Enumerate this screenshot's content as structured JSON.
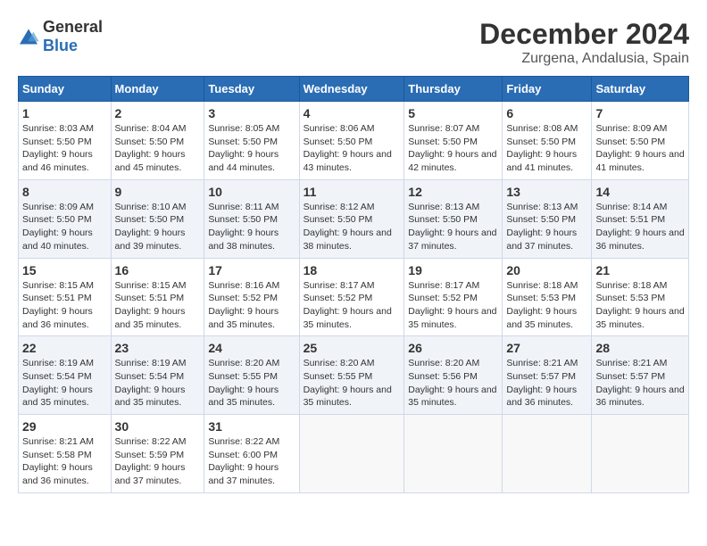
{
  "logo": {
    "general": "General",
    "blue": "Blue"
  },
  "title": "December 2024",
  "subtitle": "Zurgena, Andalusia, Spain",
  "days_of_week": [
    "Sunday",
    "Monday",
    "Tuesday",
    "Wednesday",
    "Thursday",
    "Friday",
    "Saturday"
  ],
  "weeks": [
    [
      {
        "day": 1,
        "sunrise": "Sunrise: 8:03 AM",
        "sunset": "Sunset: 5:50 PM",
        "daylight": "Daylight: 9 hours and 46 minutes."
      },
      {
        "day": 2,
        "sunrise": "Sunrise: 8:04 AM",
        "sunset": "Sunset: 5:50 PM",
        "daylight": "Daylight: 9 hours and 45 minutes."
      },
      {
        "day": 3,
        "sunrise": "Sunrise: 8:05 AM",
        "sunset": "Sunset: 5:50 PM",
        "daylight": "Daylight: 9 hours and 44 minutes."
      },
      {
        "day": 4,
        "sunrise": "Sunrise: 8:06 AM",
        "sunset": "Sunset: 5:50 PM",
        "daylight": "Daylight: 9 hours and 43 minutes."
      },
      {
        "day": 5,
        "sunrise": "Sunrise: 8:07 AM",
        "sunset": "Sunset: 5:50 PM",
        "daylight": "Daylight: 9 hours and 42 minutes."
      },
      {
        "day": 6,
        "sunrise": "Sunrise: 8:08 AM",
        "sunset": "Sunset: 5:50 PM",
        "daylight": "Daylight: 9 hours and 41 minutes."
      },
      {
        "day": 7,
        "sunrise": "Sunrise: 8:09 AM",
        "sunset": "Sunset: 5:50 PM",
        "daylight": "Daylight: 9 hours and 41 minutes."
      }
    ],
    [
      {
        "day": 8,
        "sunrise": "Sunrise: 8:09 AM",
        "sunset": "Sunset: 5:50 PM",
        "daylight": "Daylight: 9 hours and 40 minutes."
      },
      {
        "day": 9,
        "sunrise": "Sunrise: 8:10 AM",
        "sunset": "Sunset: 5:50 PM",
        "daylight": "Daylight: 9 hours and 39 minutes."
      },
      {
        "day": 10,
        "sunrise": "Sunrise: 8:11 AM",
        "sunset": "Sunset: 5:50 PM",
        "daylight": "Daylight: 9 hours and 38 minutes."
      },
      {
        "day": 11,
        "sunrise": "Sunrise: 8:12 AM",
        "sunset": "Sunset: 5:50 PM",
        "daylight": "Daylight: 9 hours and 38 minutes."
      },
      {
        "day": 12,
        "sunrise": "Sunrise: 8:13 AM",
        "sunset": "Sunset: 5:50 PM",
        "daylight": "Daylight: 9 hours and 37 minutes."
      },
      {
        "day": 13,
        "sunrise": "Sunrise: 8:13 AM",
        "sunset": "Sunset: 5:50 PM",
        "daylight": "Daylight: 9 hours and 37 minutes."
      },
      {
        "day": 14,
        "sunrise": "Sunrise: 8:14 AM",
        "sunset": "Sunset: 5:51 PM",
        "daylight": "Daylight: 9 hours and 36 minutes."
      }
    ],
    [
      {
        "day": 15,
        "sunrise": "Sunrise: 8:15 AM",
        "sunset": "Sunset: 5:51 PM",
        "daylight": "Daylight: 9 hours and 36 minutes."
      },
      {
        "day": 16,
        "sunrise": "Sunrise: 8:15 AM",
        "sunset": "Sunset: 5:51 PM",
        "daylight": "Daylight: 9 hours and 35 minutes."
      },
      {
        "day": 17,
        "sunrise": "Sunrise: 8:16 AM",
        "sunset": "Sunset: 5:52 PM",
        "daylight": "Daylight: 9 hours and 35 minutes."
      },
      {
        "day": 18,
        "sunrise": "Sunrise: 8:17 AM",
        "sunset": "Sunset: 5:52 PM",
        "daylight": "Daylight: 9 hours and 35 minutes."
      },
      {
        "day": 19,
        "sunrise": "Sunrise: 8:17 AM",
        "sunset": "Sunset: 5:52 PM",
        "daylight": "Daylight: 9 hours and 35 minutes."
      },
      {
        "day": 20,
        "sunrise": "Sunrise: 8:18 AM",
        "sunset": "Sunset: 5:53 PM",
        "daylight": "Daylight: 9 hours and 35 minutes."
      },
      {
        "day": 21,
        "sunrise": "Sunrise: 8:18 AM",
        "sunset": "Sunset: 5:53 PM",
        "daylight": "Daylight: 9 hours and 35 minutes."
      }
    ],
    [
      {
        "day": 22,
        "sunrise": "Sunrise: 8:19 AM",
        "sunset": "Sunset: 5:54 PM",
        "daylight": "Daylight: 9 hours and 35 minutes."
      },
      {
        "day": 23,
        "sunrise": "Sunrise: 8:19 AM",
        "sunset": "Sunset: 5:54 PM",
        "daylight": "Daylight: 9 hours and 35 minutes."
      },
      {
        "day": 24,
        "sunrise": "Sunrise: 8:20 AM",
        "sunset": "Sunset: 5:55 PM",
        "daylight": "Daylight: 9 hours and 35 minutes."
      },
      {
        "day": 25,
        "sunrise": "Sunrise: 8:20 AM",
        "sunset": "Sunset: 5:55 PM",
        "daylight": "Daylight: 9 hours and 35 minutes."
      },
      {
        "day": 26,
        "sunrise": "Sunrise: 8:20 AM",
        "sunset": "Sunset: 5:56 PM",
        "daylight": "Daylight: 9 hours and 35 minutes."
      },
      {
        "day": 27,
        "sunrise": "Sunrise: 8:21 AM",
        "sunset": "Sunset: 5:57 PM",
        "daylight": "Daylight: 9 hours and 36 minutes."
      },
      {
        "day": 28,
        "sunrise": "Sunrise: 8:21 AM",
        "sunset": "Sunset: 5:57 PM",
        "daylight": "Daylight: 9 hours and 36 minutes."
      }
    ],
    [
      {
        "day": 29,
        "sunrise": "Sunrise: 8:21 AM",
        "sunset": "Sunset: 5:58 PM",
        "daylight": "Daylight: 9 hours and 36 minutes."
      },
      {
        "day": 30,
        "sunrise": "Sunrise: 8:22 AM",
        "sunset": "Sunset: 5:59 PM",
        "daylight": "Daylight: 9 hours and 37 minutes."
      },
      {
        "day": 31,
        "sunrise": "Sunrise: 8:22 AM",
        "sunset": "Sunset: 6:00 PM",
        "daylight": "Daylight: 9 hours and 37 minutes."
      },
      null,
      null,
      null,
      null
    ]
  ]
}
